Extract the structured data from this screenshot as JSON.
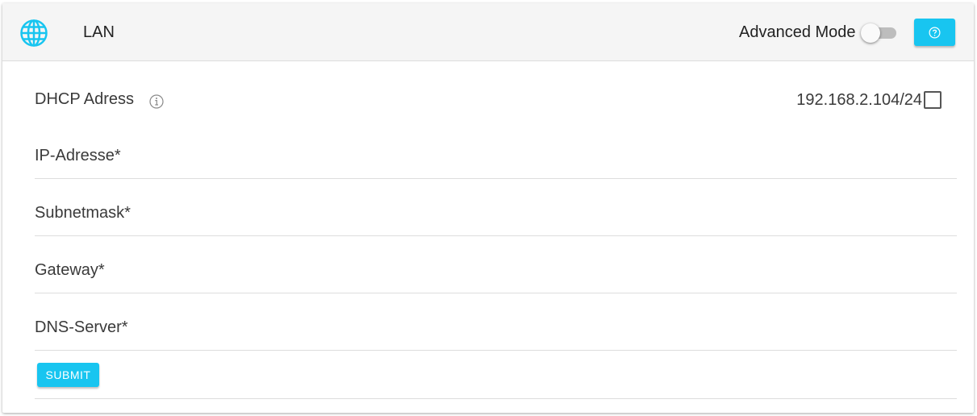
{
  "header": {
    "icon": "globe-icon",
    "title": "LAN",
    "advanced_mode_label": "Advanced Mode",
    "advanced_mode_on": false,
    "help_icon": "question-circle-icon"
  },
  "form": {
    "dhcp": {
      "label": "DHCP Adress",
      "info_icon": "info-icon",
      "value": "192.168.2.104/24",
      "checked": false
    },
    "fields": [
      {
        "label": "IP-Adresse*"
      },
      {
        "label": "Subnetmask*"
      },
      {
        "label": "Gateway*"
      },
      {
        "label": "DNS-Server*"
      }
    ],
    "submit_label": "SUBMIT"
  },
  "colors": {
    "accent": "#18c5f0",
    "header_bg": "#f5f5f5",
    "toggle_track": "#bdbdbd",
    "text": "#3a3a3a"
  }
}
